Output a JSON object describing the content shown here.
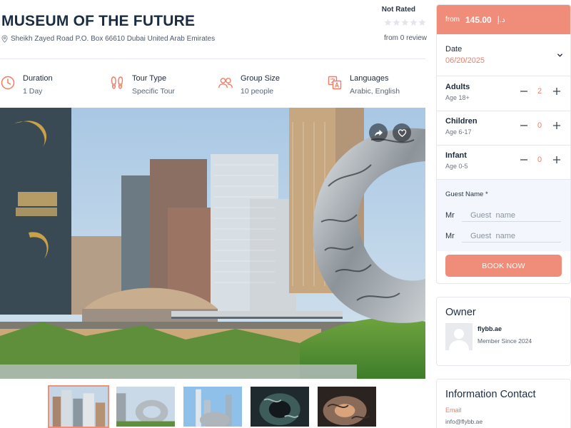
{
  "tour": {
    "title": "MUSEUM OF THE FUTURE",
    "address": "Sheikh Zayed Road P.O. Box 66610 Dubai United Arab Emirates",
    "rating": {
      "status": "Not Rated",
      "stars": 0,
      "review_text": "from 0 review"
    }
  },
  "features": [
    {
      "icon": "clock-icon",
      "label": "Duration",
      "value": "1 Day"
    },
    {
      "icon": "footprints-icon",
      "label": "Tour Type",
      "value": "Specific Tour"
    },
    {
      "icon": "users-icon",
      "label": "Group Size",
      "value": "10 people"
    },
    {
      "icon": "translate-icon",
      "label": "Languages",
      "value": "Arabic, English"
    }
  ],
  "gallery": {
    "thumbnail_count": 5,
    "active_index": 0
  },
  "booking": {
    "price_from": "from",
    "price": "145.00",
    "currency": "د.إ",
    "date_label": "Date",
    "date_value": "06/20/2025",
    "passengers": [
      {
        "title": "Adults",
        "sub": "Age 18+",
        "count": "2"
      },
      {
        "title": "Children",
        "sub": "Age 6-17",
        "count": "0"
      },
      {
        "title": "Infant",
        "sub": "Age 0-5",
        "count": "0"
      }
    ],
    "guest_label": "Guest Name *",
    "guests": [
      {
        "title": "Mr",
        "placeholder": "Guest  name"
      },
      {
        "title": "Mr",
        "placeholder": "Guest  name"
      }
    ],
    "book_label": "BOOK NOW"
  },
  "owner": {
    "title": "Owner",
    "name": "flybb.ae",
    "since": "Member Since 2024"
  },
  "contact": {
    "title": "Information Contact",
    "email_label": "Email",
    "email": "info@flybb.ae"
  },
  "colors": {
    "accent": "#ef8d7a",
    "accent_text": "#ef7d66",
    "heading": "#1b2d45",
    "guest_bg": "#f3f7fd"
  }
}
